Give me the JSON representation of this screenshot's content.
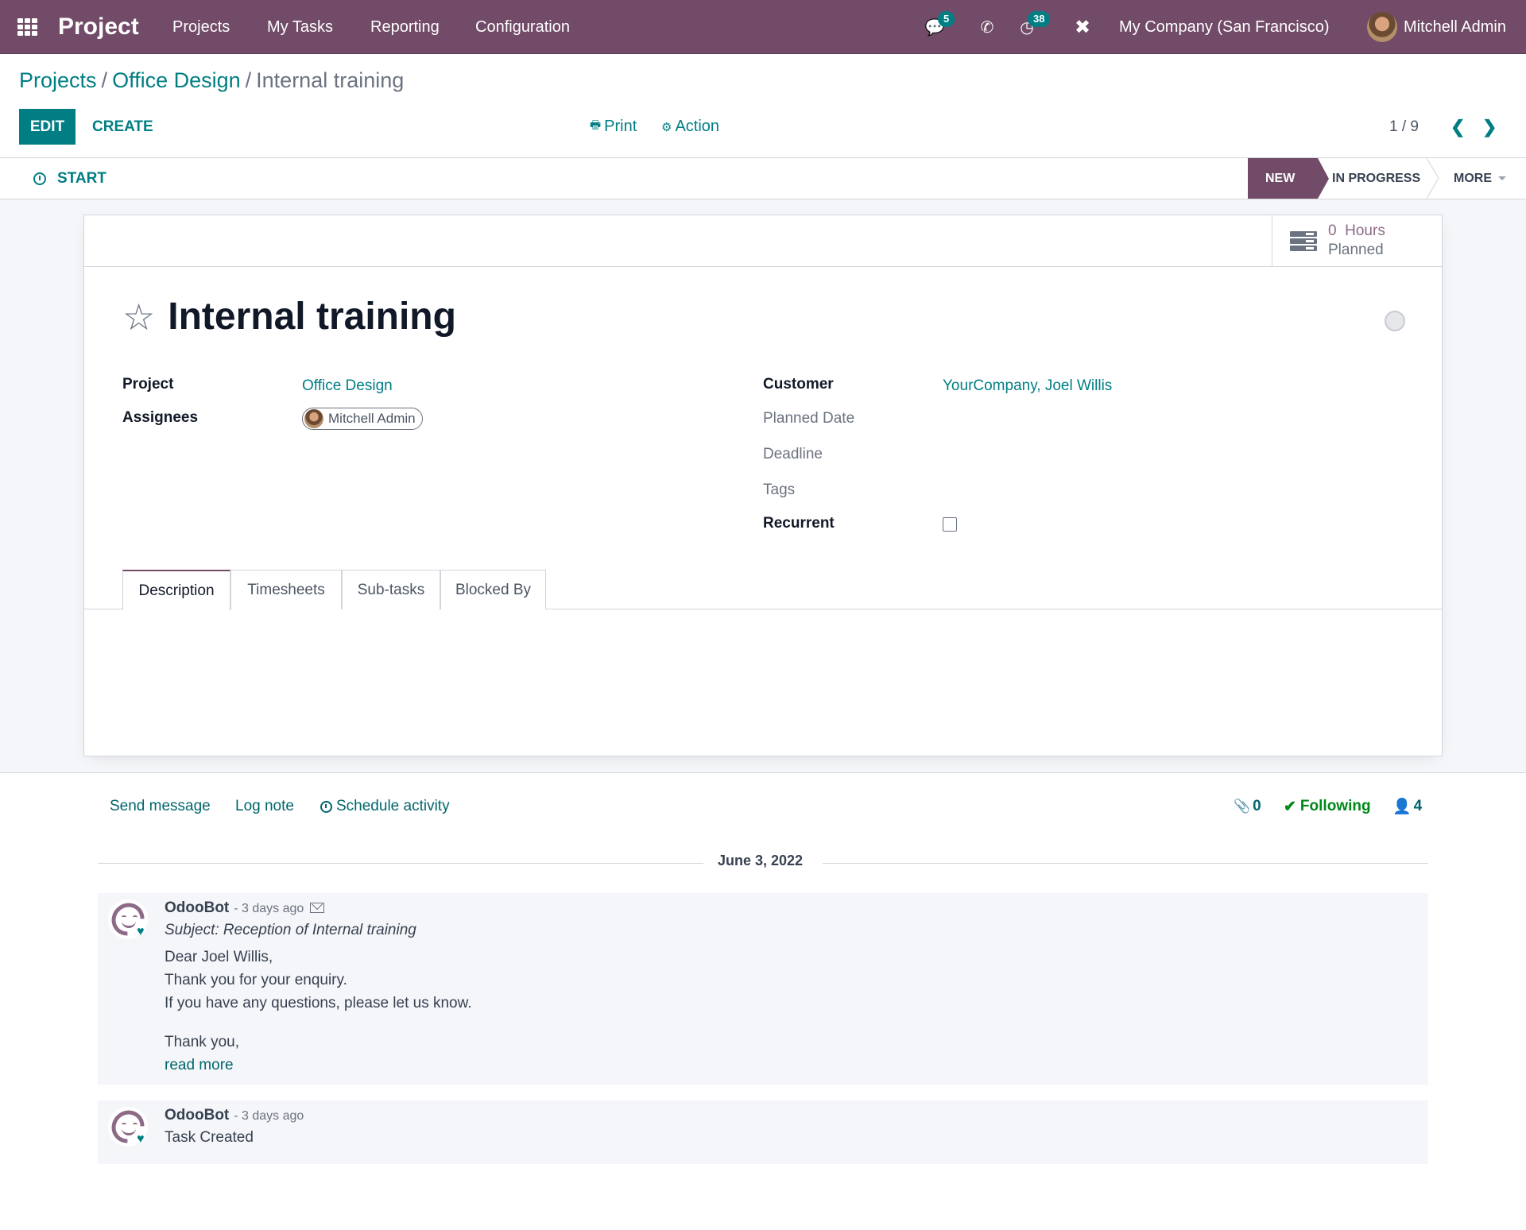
{
  "navbar": {
    "app_name": "Project",
    "menus": [
      "Projects",
      "My Tasks",
      "Reporting",
      "Configuration"
    ],
    "messages_badge": "5",
    "activities_badge": "38",
    "company": "My Company (San Francisco)",
    "user": "Mitchell Admin",
    "icons": {
      "apps": "apps-grid-icon",
      "messages": "chat-bubbles-icon",
      "phone": "phone-icon",
      "activities": "clock-icon",
      "debug": "tools-icon"
    }
  },
  "breadcrumb": {
    "items": [
      "Projects",
      "Office Design"
    ],
    "separator": "/",
    "current": "Internal training"
  },
  "control_panel": {
    "edit_label": "EDIT",
    "create_label": "CREATE",
    "print_label": "Print",
    "action_label": "Action",
    "pager": "1 / 9"
  },
  "statusbar": {
    "start_label": "START",
    "stages": [
      {
        "label": "NEW",
        "active": true
      },
      {
        "label": "IN PROGRESS",
        "active": false
      }
    ],
    "more_label": "MORE"
  },
  "sheet": {
    "stat_button": {
      "value": "0",
      "unit": "Hours",
      "label": "Planned"
    },
    "title": "Internal training",
    "starred": false,
    "kanban_state": "normal",
    "left_fields": [
      {
        "label": "Project",
        "value": "Office Design"
      },
      {
        "label": "Assignees",
        "value": "Mitchell Admin"
      }
    ],
    "right_fields": [
      {
        "label": "Customer",
        "value": "YourCompany, Joel Willis"
      },
      {
        "label": "Planned Date",
        "value": ""
      },
      {
        "label": "Deadline",
        "value": ""
      },
      {
        "label": "Tags",
        "value": ""
      },
      {
        "label": "Recurrent",
        "value": false
      }
    ],
    "tabs": [
      {
        "label": "Description",
        "active": true
      },
      {
        "label": "Timesheets",
        "active": false
      },
      {
        "label": "Sub-tasks",
        "active": false
      },
      {
        "label": "Blocked By",
        "active": false
      }
    ]
  },
  "chatter": {
    "send_message": "Send message",
    "log_note": "Log note",
    "schedule_activity": "Schedule activity",
    "attachments_count": "0",
    "following_label": "Following",
    "followers_count": "4",
    "date_separator": "June 3, 2022",
    "messages": [
      {
        "author": "OdooBot",
        "date": "- 3 days ago",
        "subject": "Subject: Reception of Internal training",
        "body": [
          "Dear Joel Willis,",
          "Thank you for your enquiry.",
          "If you have any questions, please let us know.",
          "",
          "Thank you,"
        ],
        "read_more": "read more"
      },
      {
        "author": "OdooBot",
        "date": "- 3 days ago",
        "body": [
          "Task Created"
        ]
      }
    ]
  },
  "colors": {
    "brand": "#714b67",
    "accent": "#017e84",
    "following": "#008818"
  }
}
